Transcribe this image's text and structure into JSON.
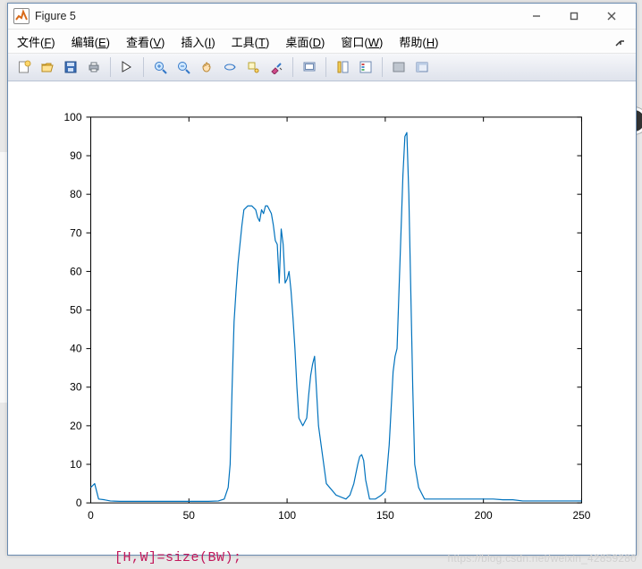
{
  "window": {
    "title": "Figure 5"
  },
  "menu": {
    "file": "文件(F)",
    "file_ul": "F",
    "edit": "编辑(E)",
    "edit_ul": "E",
    "view": "查看(V)",
    "view_ul": "V",
    "insert": "插入(I)",
    "insert_ul": "I",
    "tools": "工具(T)",
    "tools_ul": "T",
    "desktop": "桌面(D)",
    "desktop_ul": "D",
    "window_": "窗口(W)",
    "window_ul": "W",
    "help": "帮助(H)",
    "help_ul": "H"
  },
  "watermark": "https://blog.csdn.net/weixin_42859280",
  "code_fragment": "[H,W]=size(BW);",
  "chart_data": {
    "type": "line",
    "title": "",
    "xlabel": "",
    "ylabel": "",
    "xlim": [
      0,
      250
    ],
    "ylim": [
      0,
      100
    ],
    "xticks": [
      0,
      50,
      100,
      150,
      200,
      250
    ],
    "yticks": [
      0,
      10,
      20,
      30,
      40,
      50,
      60,
      70,
      80,
      90,
      100
    ],
    "series": [
      {
        "name": "",
        "color": "#0072bd",
        "x": [
          0,
          2,
          3,
          4,
          7,
          10,
          15,
          20,
          25,
          30,
          35,
          40,
          45,
          50,
          55,
          60,
          65,
          68,
          70,
          71,
          72,
          73,
          74,
          75,
          76,
          77,
          78,
          80,
          82,
          84,
          85,
          86,
          87,
          88,
          89,
          90,
          91,
          92,
          93,
          94,
          95,
          96,
          97,
          98,
          99,
          100,
          101,
          102,
          103,
          104,
          105,
          106,
          108,
          110,
          111,
          112,
          113,
          114,
          116,
          120,
          125,
          130,
          132,
          134,
          136,
          137,
          138,
          139,
          140,
          142,
          145,
          148,
          150,
          152,
          154,
          155,
          156,
          157,
          158,
          159,
          160,
          161,
          162,
          163,
          164,
          165,
          167,
          170,
          175,
          180,
          185,
          190,
          195,
          200,
          205,
          210,
          215,
          220,
          230,
          250
        ],
        "y": [
          4,
          5,
          3,
          1,
          0.8,
          0.5,
          0.4,
          0.4,
          0.4,
          0.4,
          0.4,
          0.4,
          0.4,
          0.4,
          0.4,
          0.4,
          0.5,
          1,
          4,
          10,
          30,
          47,
          55,
          62,
          67,
          72,
          76,
          77,
          77,
          76,
          74,
          73,
          76,
          75,
          77,
          77,
          76,
          75,
          72,
          68,
          67,
          57,
          71,
          67,
          57,
          58,
          60,
          55,
          48,
          40,
          30,
          22,
          20,
          22,
          28,
          33,
          36,
          38,
          20,
          5,
          2,
          1,
          2,
          5,
          10,
          12,
          12.5,
          11,
          6,
          1,
          1,
          2,
          3,
          15,
          34,
          38,
          40,
          55,
          70,
          85,
          95,
          96,
          80,
          55,
          30,
          10,
          4,
          1,
          1,
          1,
          1,
          1,
          1,
          1,
          1,
          0.8,
          0.8,
          0.5,
          0.5,
          0.5
        ]
      }
    ]
  }
}
